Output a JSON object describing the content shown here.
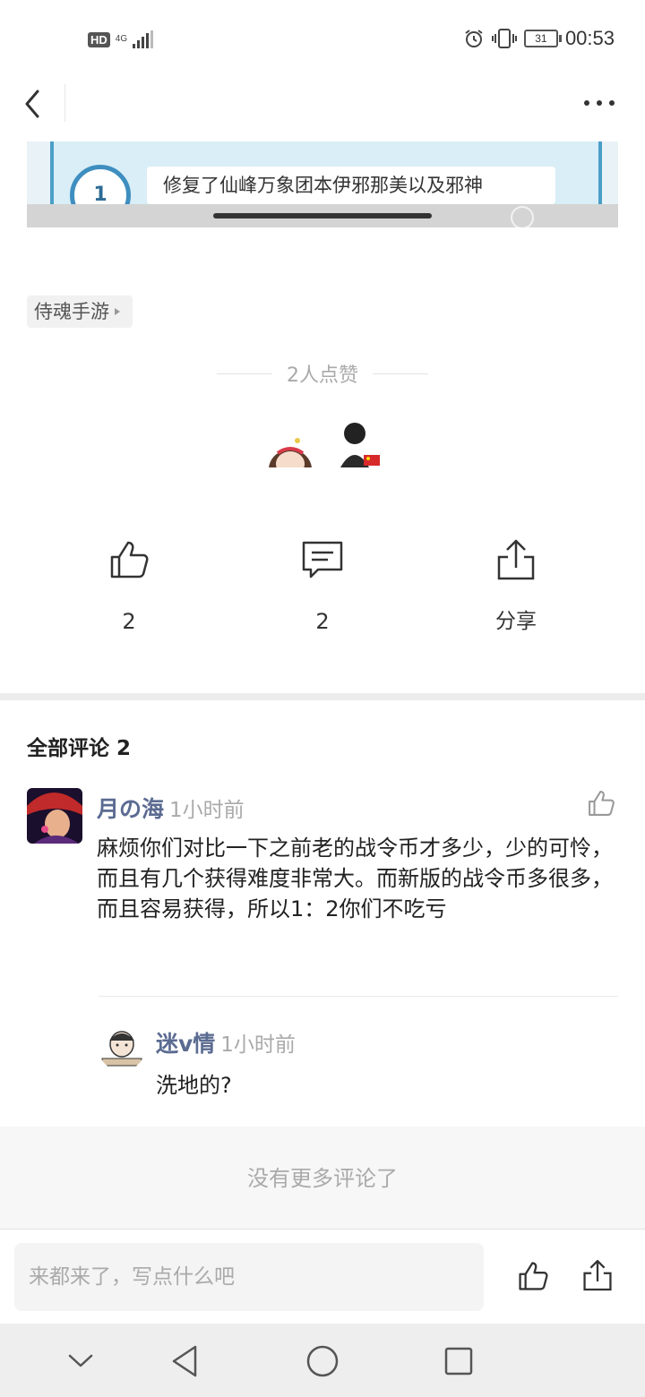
{
  "status_bar": {
    "hd_badge": "HD",
    "network_type": "4G",
    "battery_level": "31",
    "time": "00:53"
  },
  "header": {
    "back_icon": "chevron-left-icon",
    "more_icon": "more-horizontal-icon"
  },
  "preview": {
    "step_number": "1",
    "text": "修复了仙峰万象团本伊邪那美以及邪神"
  },
  "tag": {
    "label": "侍魂手游"
  },
  "likes": {
    "summary": "2人点赞"
  },
  "actions": {
    "like_count": "2",
    "comment_count": "2",
    "share_label": "分享"
  },
  "comments": {
    "title": "全部评论 2",
    "items": [
      {
        "author": "月の海",
        "time": "1小时前",
        "text": "麻烦你们对比一下之前老的战令币才多少，少的可怜，而且有几个获得难度非常大。而新版的战令币多很多，而且容易获得，所以1：2你们不吃亏",
        "reply": {
          "author": "迷v情",
          "time": "1小时前",
          "text": "洗地的?"
        }
      }
    ],
    "end_text": "没有更多评论了"
  },
  "bottom_bar": {
    "input_placeholder": "来都来了，写点什么吧"
  },
  "colors": {
    "author_name": "#5b6b91",
    "muted_text": "#aaaaaa",
    "preview_accent": "#3f8ec0"
  }
}
